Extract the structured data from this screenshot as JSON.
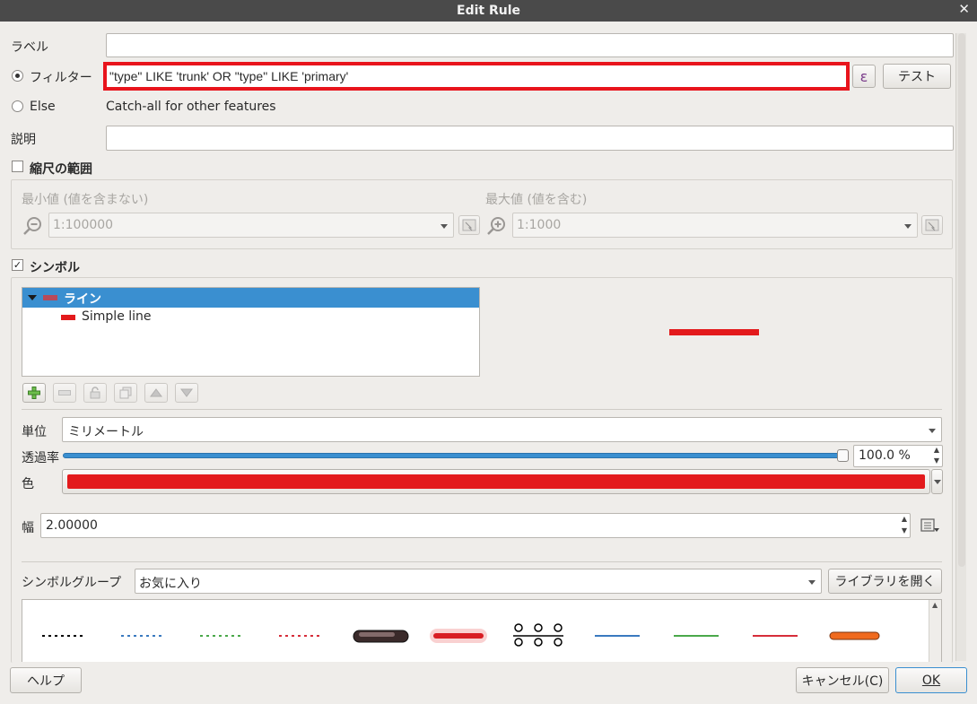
{
  "window": {
    "title": "Edit Rule"
  },
  "label_row": {
    "label": "ラベル",
    "value": ""
  },
  "filter_row": {
    "label": "フィルター",
    "expression": "\"type\" LIKE 'trunk' OR \"type\" LIKE 'primary'",
    "epsilon": "ε",
    "test_button": "テスト"
  },
  "else_row": {
    "label": "Else",
    "text": "Catch-all for other features"
  },
  "description_row": {
    "label": "説明",
    "value": ""
  },
  "scale_range": {
    "label": "縮尺の範囲",
    "checked": false,
    "min_label": "最小値 (値を含まない)",
    "min_value": "1:100000",
    "max_label": "最大値 (値を含む)",
    "max_value": "1:1000"
  },
  "symbol": {
    "label": "シンボル",
    "checked": true,
    "tree": [
      {
        "label": "ライン",
        "color": "#b84a5a",
        "selected": true
      },
      {
        "label": "Simple line",
        "color": "#e31a1c",
        "selected": false
      }
    ],
    "preview_color": "#e31a1c"
  },
  "properties": {
    "unit_label": "単位",
    "unit_value": "ミリメートル",
    "opacity_label": "透過率",
    "opacity_value": "100.0 %",
    "opacity_fraction": 1.0,
    "color_label": "色",
    "color_value": "#e31a1c",
    "width_label": "幅",
    "width_value": "2.00000"
  },
  "symbol_group": {
    "label": "シンボルグループ",
    "value": "お気に入り",
    "open_library": "ライブラリを開く"
  },
  "footer": {
    "help": "ヘルプ",
    "cancel": "キャンセル(C)",
    "ok": "OK"
  }
}
